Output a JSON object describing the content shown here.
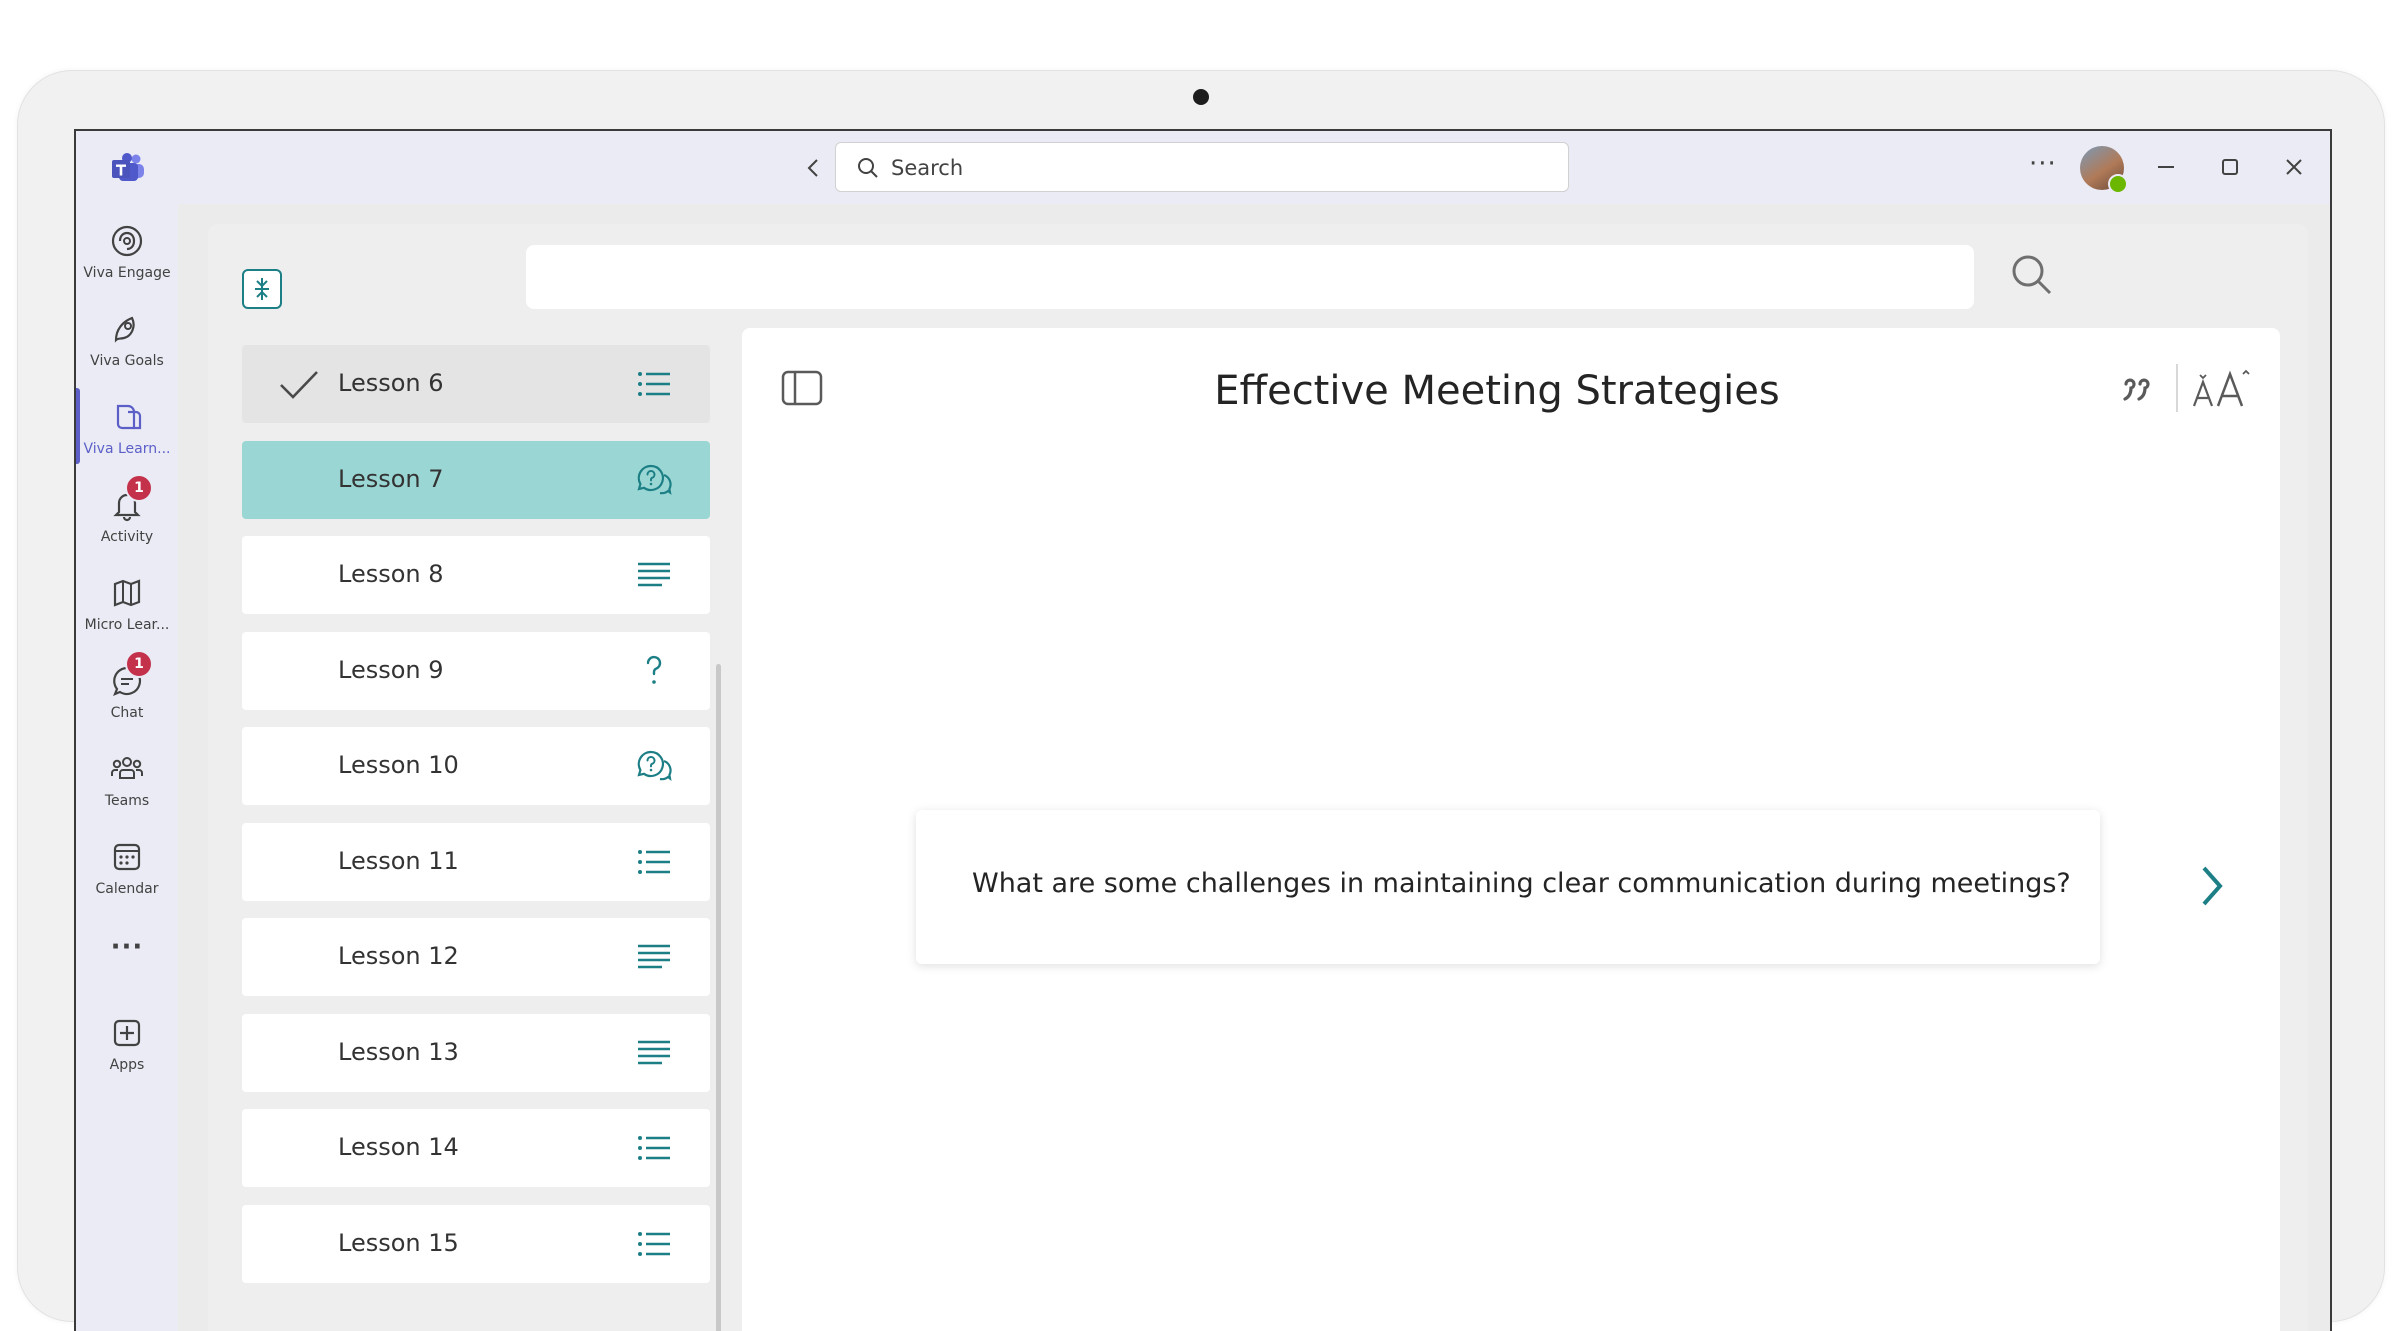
{
  "titlebar": {
    "search_placeholder": "Search",
    "back_icon": "chevron-left-icon",
    "forward_icon": "chevron-right-icon",
    "more_label": "···"
  },
  "rail": {
    "items": [
      {
        "label": "Viva Engage",
        "icon": "viva-engage-icon"
      },
      {
        "label": "Viva Goals",
        "icon": "viva-goals-icon"
      },
      {
        "label": "Viva Learn...",
        "icon": "viva-learning-icon",
        "active": true
      },
      {
        "label": "Activity",
        "icon": "bell-icon",
        "badge": "1"
      },
      {
        "label": "Micro Lear...",
        "icon": "book-icon"
      },
      {
        "label": "Chat",
        "icon": "chat-icon",
        "badge": "1"
      },
      {
        "label": "Teams",
        "icon": "teams-people-icon"
      },
      {
        "label": "Calendar",
        "icon": "calendar-icon"
      },
      {
        "label": "",
        "icon": "more-apps-icon"
      },
      {
        "label": "Apps",
        "icon": "add-apps-icon"
      }
    ],
    "more_label": "···"
  },
  "lessons": [
    {
      "label": "Lesson 6",
      "type": "list",
      "state": "completed"
    },
    {
      "label": "Lesson 7",
      "type": "discussion",
      "state": "active"
    },
    {
      "label": "Lesson 8",
      "type": "text",
      "state": "default"
    },
    {
      "label": "Lesson 9",
      "type": "quiz",
      "state": "default"
    },
    {
      "label": "Lesson 10",
      "type": "discussion",
      "state": "default"
    },
    {
      "label": "Lesson 11",
      "type": "list",
      "state": "default"
    },
    {
      "label": "Lesson 12",
      "type": "text",
      "state": "default"
    },
    {
      "label": "Lesson 13",
      "type": "text",
      "state": "default"
    },
    {
      "label": "Lesson 14",
      "type": "list",
      "state": "default"
    },
    {
      "label": "Lesson 15",
      "type": "list",
      "state": "default"
    }
  ],
  "content": {
    "title": "Effective Meeting Strategies",
    "question": "What are some challenges in maintaining clear communication during meetings?"
  },
  "colors": {
    "accent_teal": "#1d7f86",
    "active_lesson": "#9ad7d4",
    "teams_purple": "#5b5fc7",
    "badge_red": "#c4314b"
  }
}
